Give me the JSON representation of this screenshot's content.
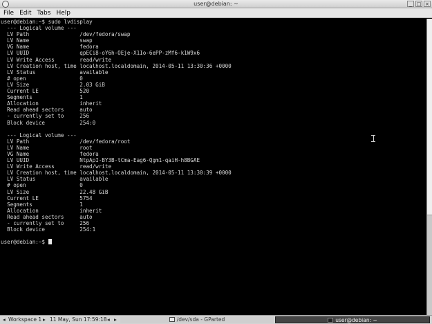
{
  "window": {
    "title": "user@debian: ~",
    "minimize_label": "_",
    "maximize_label": "□",
    "close_label": "×"
  },
  "menu": {
    "file": "File",
    "edit": "Edit",
    "tabs": "Tabs",
    "help": "Help"
  },
  "terminal": {
    "lines": [
      "user@debian:~$ sudo lvdisplay",
      "  --- Logical volume ---",
      "  LV Path                /dev/fedora/swap",
      "  LV Name                swap",
      "  VG Name                fedora",
      "  LV UUID                qpECi8-oY6h-OEje-X1Io-6ePP-zMf6-k1W9x6",
      "  LV Write Access        read/write",
      "  LV Creation host, time localhost.localdomain, 2014-05-11 13:30:36 +0000",
      "  LV Status              available",
      "  # open                 0",
      "  LV Size                2.03 GiB",
      "  Current LE             520",
      "  Segments               1",
      "  Allocation             inherit",
      "  Read ahead sectors     auto",
      "  - currently set to     256",
      "  Block device           254:0",
      "",
      "  --- Logical volume ---",
      "  LV Path                /dev/fedora/root",
      "  LV Name                root",
      "  VG Name                fedora",
      "  LV UUID                NtpApI-BY3B-tCma-Eag6-Qgm1-qaiH-h8BGAE",
      "  LV Write Access        read/write",
      "  LV Creation host, time localhost.localdomain, 2014-05-11 13:30:39 +0000",
      "  LV Status              available",
      "  # open                 0",
      "  LV Size                22.48 GiB",
      "  Current LE             5754",
      "  Segments               1",
      "  Allocation             inherit",
      "  Read ahead sectors     auto",
      "  - currently set to     256",
      "  Block device           254:1",
      ""
    ],
    "prompt": "user@debian:~$ "
  },
  "taskbar": {
    "workspace": "Workspace 1",
    "datetime": "11 May, Sun 17:59:18",
    "task_gparted": "/dev/sda - GParted",
    "task_terminal": "user@debian: ~"
  },
  "colors": {
    "terminal_bg": "#000000",
    "terminal_fg": "#d8d8d8",
    "taskbar_bg": "#d4d4d4"
  }
}
